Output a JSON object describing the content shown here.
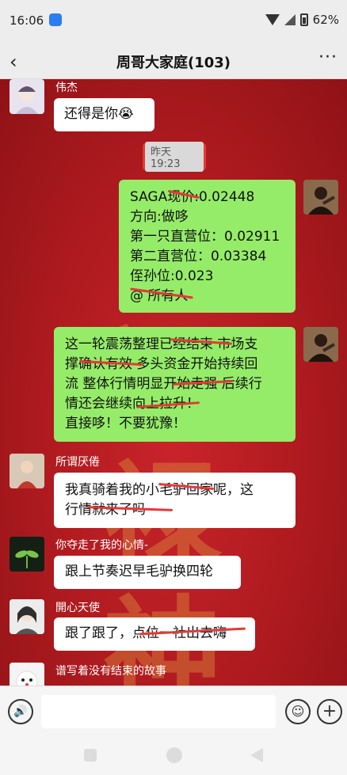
{
  "status": {
    "time": "16:06",
    "battery": "62%"
  },
  "header": {
    "title": "周哥大家庭(103)",
    "back_glyph": "‹",
    "more_glyph": "···"
  },
  "messages": [
    {
      "sender": "伟杰",
      "text": "还得是你😭"
    },
    {
      "timestamp": "昨天 19:23"
    },
    {
      "text": "SAGA现价:0.02448\n方向:做哆\n第一只直营位：0.02911\n第二直营位：0.03384\n侄孙位:0.023\n@ 所有人"
    },
    {
      "text": "这一轮震荡整理已经结束 市场支\n撑确认有效 多头资金开始持续回\n流 整体行情明显开始走强 后续行\n情还会继续向上拉升！\n直接哆！不要犹豫！"
    },
    {
      "sender": "所谓厌倦",
      "text": "我真骑着我的小毛驴回家呢，这\n行情就来了吗"
    },
    {
      "sender": "你夺走了我的心情-",
      "text": "跟上节奏迟早毛驴换四轮"
    },
    {
      "sender": "開心天使",
      "text": "跟了跟了，点位一社出去嗨"
    },
    {
      "sender": "谱写着没有结束的故事"
    }
  ],
  "input": {
    "voice_glyph": "🔊",
    "emoji_glyph": "☺",
    "plus_glyph": "+"
  },
  "colors": {
    "wechat_green": "#95ec69",
    "highlight_red": "#e53935",
    "background_red": "#b01b20"
  }
}
